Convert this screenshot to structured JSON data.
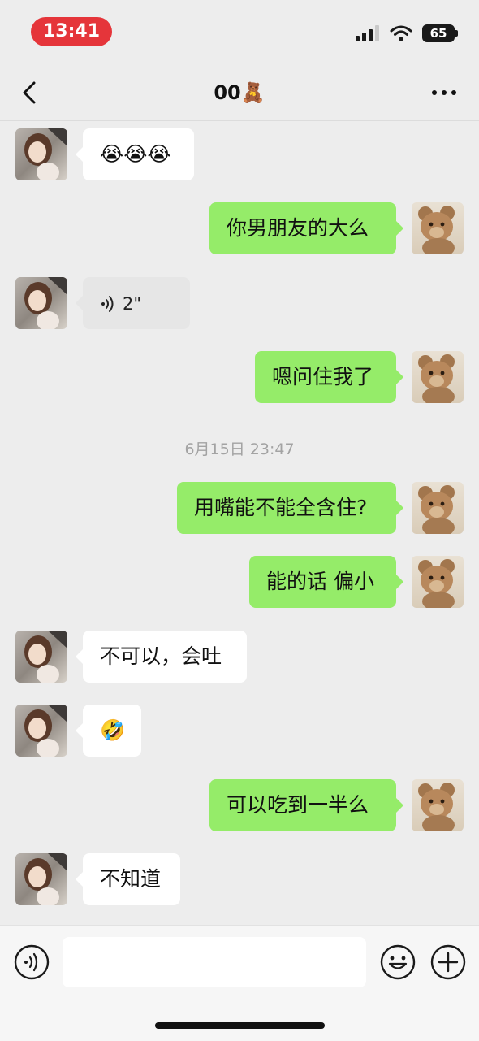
{
  "status_bar": {
    "time": "13:41",
    "battery": "65"
  },
  "header": {
    "title": "00🧸"
  },
  "messages": [
    {
      "side": "left",
      "text": "😭😭😭"
    },
    {
      "side": "right",
      "text": "你男朋友的大么"
    },
    {
      "side": "left",
      "voice_duration": "2\""
    },
    {
      "side": "right",
      "text": "嗯问住我了"
    },
    {
      "timestamp": "6月15日 23:47"
    },
    {
      "side": "right",
      "text": "用嘴能不能全含住?"
    },
    {
      "side": "right",
      "text": "能的话 偏小"
    },
    {
      "side": "left",
      "text": "不可以，会吐"
    },
    {
      "side": "left",
      "text": "🤣"
    },
    {
      "side": "right",
      "text": "可以吃到一半么"
    },
    {
      "side": "left",
      "text": "不知道"
    }
  ],
  "input_bar": {
    "value": "",
    "icons": [
      "voice-icon",
      "emoji-icon",
      "plus-icon"
    ]
  },
  "colors": {
    "accent": "#95ec69",
    "background": "#ededed",
    "status_pill": "#e5353a"
  }
}
